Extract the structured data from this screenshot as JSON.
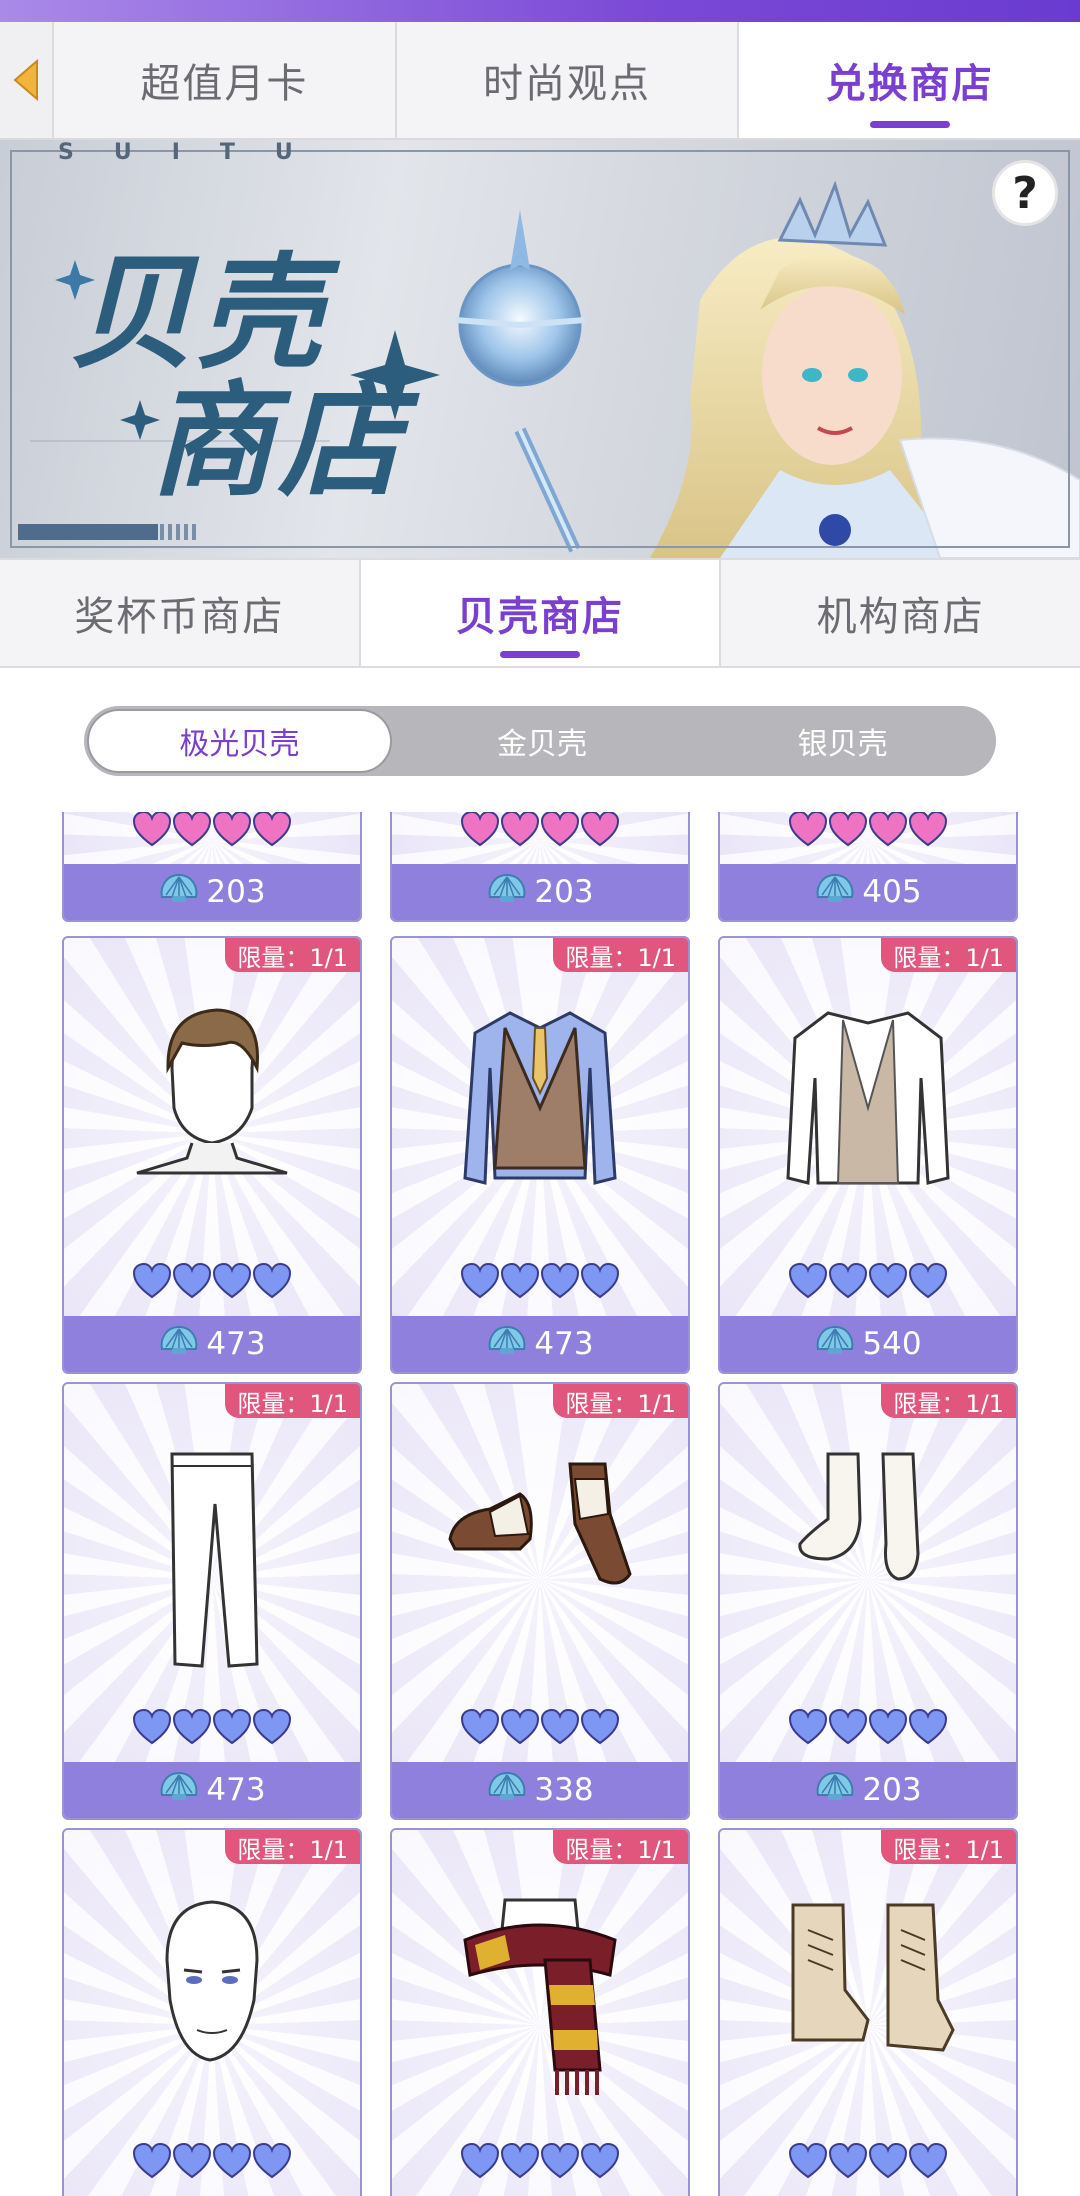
{
  "main_tabs": [
    {
      "label": "超值月卡",
      "active": false
    },
    {
      "label": "时尚观点",
      "active": false
    },
    {
      "label": "兑换商店",
      "active": true
    }
  ],
  "banner": {
    "letters": "SUITU",
    "title_line1": "贝壳",
    "title_line2": "商店",
    "help_label": "?"
  },
  "sub_tabs": [
    {
      "label": "奖杯币商店",
      "active": false
    },
    {
      "label": "贝壳商店",
      "active": true
    },
    {
      "label": "机构商店",
      "active": false
    }
  ],
  "segment": [
    {
      "label": "极光贝壳",
      "active": true
    },
    {
      "label": "金贝壳",
      "active": false
    },
    {
      "label": "银贝壳",
      "active": false
    }
  ],
  "colors": {
    "accent": "#7b3fd0",
    "price_bg": "#8f80dd",
    "limit_badge": "#e0567c",
    "heart_pink": "#ee74c3",
    "heart_blue": "#7d97f2"
  },
  "items": [
    {
      "row": 0,
      "col": 0,
      "limit": "",
      "heart_color": "pink",
      "hearts": 4,
      "price": "203",
      "icon": "partial-item"
    },
    {
      "row": 0,
      "col": 1,
      "limit": "",
      "heart_color": "pink",
      "hearts": 4,
      "price": "203",
      "icon": "partial-item"
    },
    {
      "row": 0,
      "col": 2,
      "limit": "",
      "heart_color": "pink",
      "hearts": 4,
      "price": "405",
      "icon": "partial-item"
    },
    {
      "row": 1,
      "col": 0,
      "limit": "限量：1/1",
      "heart_color": "blue",
      "hearts": 4,
      "price": "473",
      "icon": "hairstyle-icon"
    },
    {
      "row": 1,
      "col": 1,
      "limit": "限量：1/1",
      "heart_color": "blue",
      "hearts": 4,
      "price": "473",
      "icon": "vest-shirt-icon"
    },
    {
      "row": 1,
      "col": 2,
      "limit": "限量：1/1",
      "heart_color": "blue",
      "hearts": 4,
      "price": "540",
      "icon": "white-jacket-icon"
    },
    {
      "row": 2,
      "col": 0,
      "limit": "限量：1/1",
      "heart_color": "blue",
      "hearts": 4,
      "price": "473",
      "icon": "white-trousers-icon"
    },
    {
      "row": 2,
      "col": 1,
      "limit": "限量：1/1",
      "heart_color": "blue",
      "hearts": 4,
      "price": "338",
      "icon": "brogue-shoes-icon"
    },
    {
      "row": 2,
      "col": 2,
      "limit": "限量：1/1",
      "heart_color": "blue",
      "hearts": 4,
      "price": "203",
      "icon": "white-socks-icon"
    },
    {
      "row": 3,
      "col": 0,
      "limit": "限量：1/1",
      "heart_color": "blue",
      "hearts": 4,
      "price": "",
      "icon": "face-icon"
    },
    {
      "row": 3,
      "col": 1,
      "limit": "限量：1/1",
      "heart_color": "blue",
      "hearts": 4,
      "price": "",
      "icon": "striped-scarf-icon"
    },
    {
      "row": 3,
      "col": 2,
      "limit": "限量：1/1",
      "heart_color": "blue",
      "hearts": 4,
      "price": "",
      "icon": "beige-boots-icon"
    }
  ]
}
